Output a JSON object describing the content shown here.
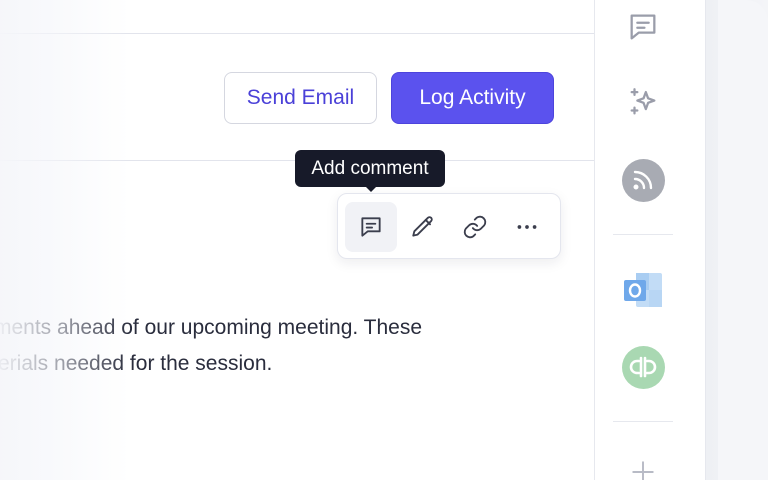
{
  "header": {
    "send_email_label": "Send Email",
    "log_activity_label": "Log Activity"
  },
  "tooltip": {
    "text": "Add comment"
  },
  "toolbar": {
    "items": [
      {
        "name": "comment",
        "icon": "comment-icon"
      },
      {
        "name": "edit",
        "icon": "pencil-icon"
      },
      {
        "name": "link",
        "icon": "link-icon"
      },
      {
        "name": "more",
        "icon": "more-horizontal-icon"
      }
    ]
  },
  "note": {
    "line1": "ments ahead of our upcoming meeting. These",
    "line2": "erials needed for the session."
  },
  "rail": {
    "items": [
      {
        "name": "comments",
        "icon": "message-square-icon"
      },
      {
        "name": "ai",
        "icon": "sparkles-icon"
      },
      {
        "name": "rss",
        "icon": "rss-icon"
      },
      {
        "name": "outlook",
        "icon": "outlook-icon"
      },
      {
        "name": "quickbooks",
        "icon": "quickbooks-icon"
      },
      {
        "name": "add",
        "icon": "plus-icon"
      }
    ]
  },
  "colors": {
    "accent": "#5b52ee",
    "accent_text": "#4a40d8",
    "tooltip_bg": "#171a29",
    "quickbooks": "#a9d8b2",
    "outlook": "#6fa8ea"
  }
}
